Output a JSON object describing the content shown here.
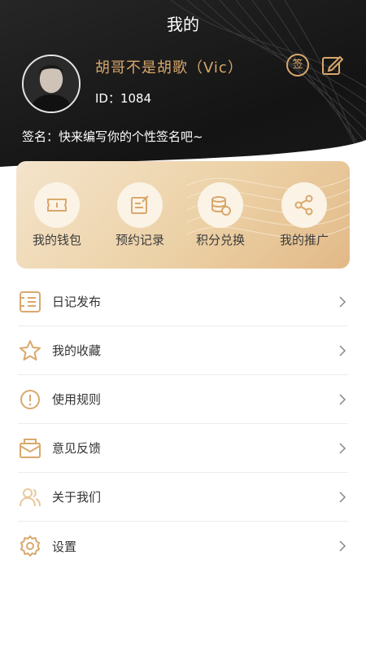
{
  "header": {
    "title": "我的",
    "username": "胡哥不是胡歌（Vic）",
    "user_id": "ID：1084",
    "signature": "签名：快来编写你的个性签名吧~",
    "checkin_label": "签"
  },
  "quick_actions": [
    {
      "label": "我的钱包",
      "icon": "ticket-icon"
    },
    {
      "label": "预约记录",
      "icon": "edit-note-icon"
    },
    {
      "label": "积分兑换",
      "icon": "coins-icon"
    },
    {
      "label": "我的推广",
      "icon": "share-icon"
    }
  ],
  "menu": [
    {
      "label": "日记发布",
      "icon": "list-icon"
    },
    {
      "label": "我的收藏",
      "icon": "star-icon"
    },
    {
      "label": "使用规则",
      "icon": "info-icon"
    },
    {
      "label": "意见反馈",
      "icon": "mail-icon"
    },
    {
      "label": "关于我们",
      "icon": "users-icon"
    },
    {
      "label": "设置",
      "icon": "gear-icon"
    }
  ],
  "colors": {
    "accent": "#d9a86c",
    "dark_header": "#1a1a1a",
    "card_gradient_start": "#f4e4cb",
    "card_gradient_end": "#e2b987"
  }
}
